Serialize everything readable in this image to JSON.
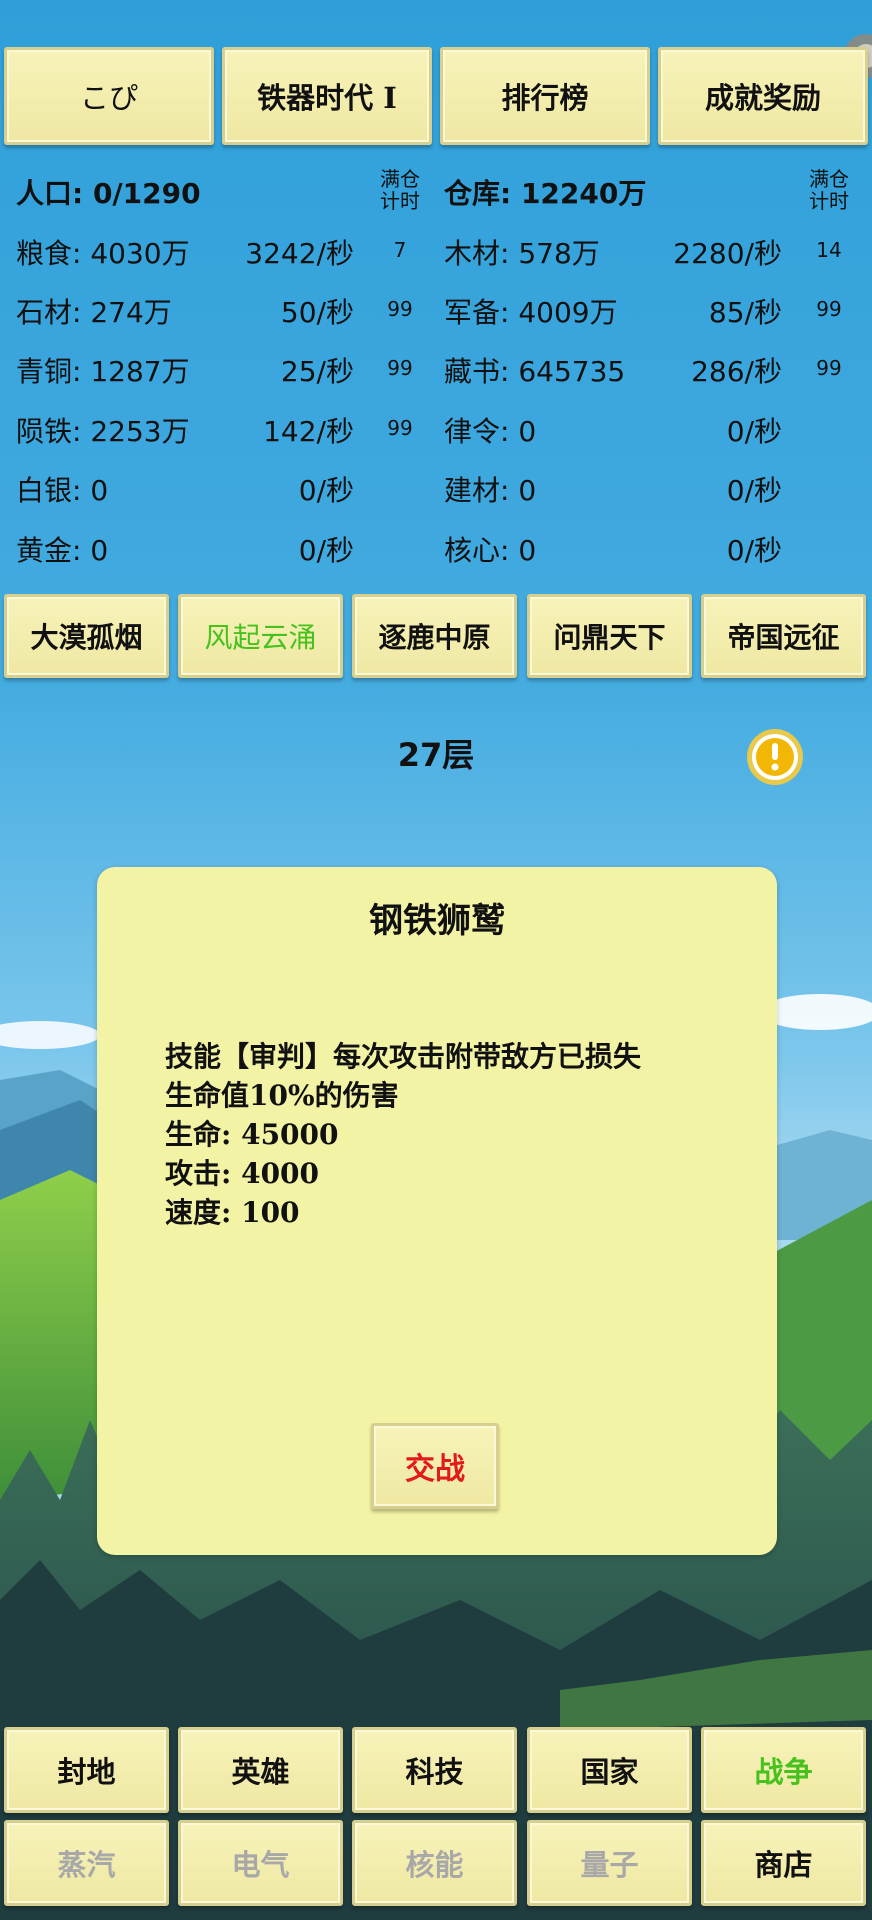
{
  "top_buttons": [
    "こぴ",
    "铁器时代 Ⅰ",
    "排行榜",
    "成就奖励"
  ],
  "resources": {
    "left_header": "人口: 0/1290",
    "right_header": "仓库: 12240万",
    "full_timer_label_1": "满仓",
    "full_timer_label_2": "计时",
    "left": [
      {
        "name": "粮食: 4030万",
        "rate": "3242/秒",
        "full": "7"
      },
      {
        "name": "石材: 274万",
        "rate": "50/秒",
        "full": "99"
      },
      {
        "name": "青铜: 1287万",
        "rate": "25/秒",
        "full": "99"
      },
      {
        "name": "陨铁: 2253万",
        "rate": "142/秒",
        "full": "99"
      },
      {
        "name": "白银: 0",
        "rate": "0/秒",
        "full": ""
      },
      {
        "name": "黄金: 0",
        "rate": "0/秒",
        "full": ""
      }
    ],
    "right": [
      {
        "name": "木材: 578万",
        "rate": "2280/秒",
        "full": "14"
      },
      {
        "name": "军备: 4009万",
        "rate": "85/秒",
        "full": "99"
      },
      {
        "name": "藏书: 645735",
        "rate": "286/秒",
        "full": "99"
      },
      {
        "name": "律令: 0",
        "rate": "0/秒",
        "full": ""
      },
      {
        "name": "建材: 0",
        "rate": "0/秒",
        "full": ""
      },
      {
        "name": "核心: 0",
        "rate": "0/秒",
        "full": ""
      }
    ]
  },
  "chapter_tabs": [
    "大漠孤烟",
    "风起云涌",
    "逐鹿中原",
    "问鼎天下",
    "帝国远征"
  ],
  "chapter_tab_active": 1,
  "floor": "27层",
  "dialog": {
    "title": "钢铁狮鹫",
    "skill_line1": "技能【审判】每次攻击附带敌方已损失",
    "skill_line2": "生命值10%的伤害",
    "hp": "生命: 45000",
    "atk": "攻击: 4000",
    "spd": "速度: 100",
    "fight_button": "交战"
  },
  "bottom_nav_row1": [
    "封地",
    "英雄",
    "科技",
    "国家",
    "战争"
  ],
  "bottom_nav_row2": [
    "蒸汽",
    "电气",
    "核能",
    "量子",
    "商店"
  ],
  "colors": {
    "sky": "#35a6dd",
    "button": "#f3edaf",
    "active_green": "#46c11d",
    "fight_red": "#e31a1a",
    "disabled_grey": "#a8a8a8"
  }
}
